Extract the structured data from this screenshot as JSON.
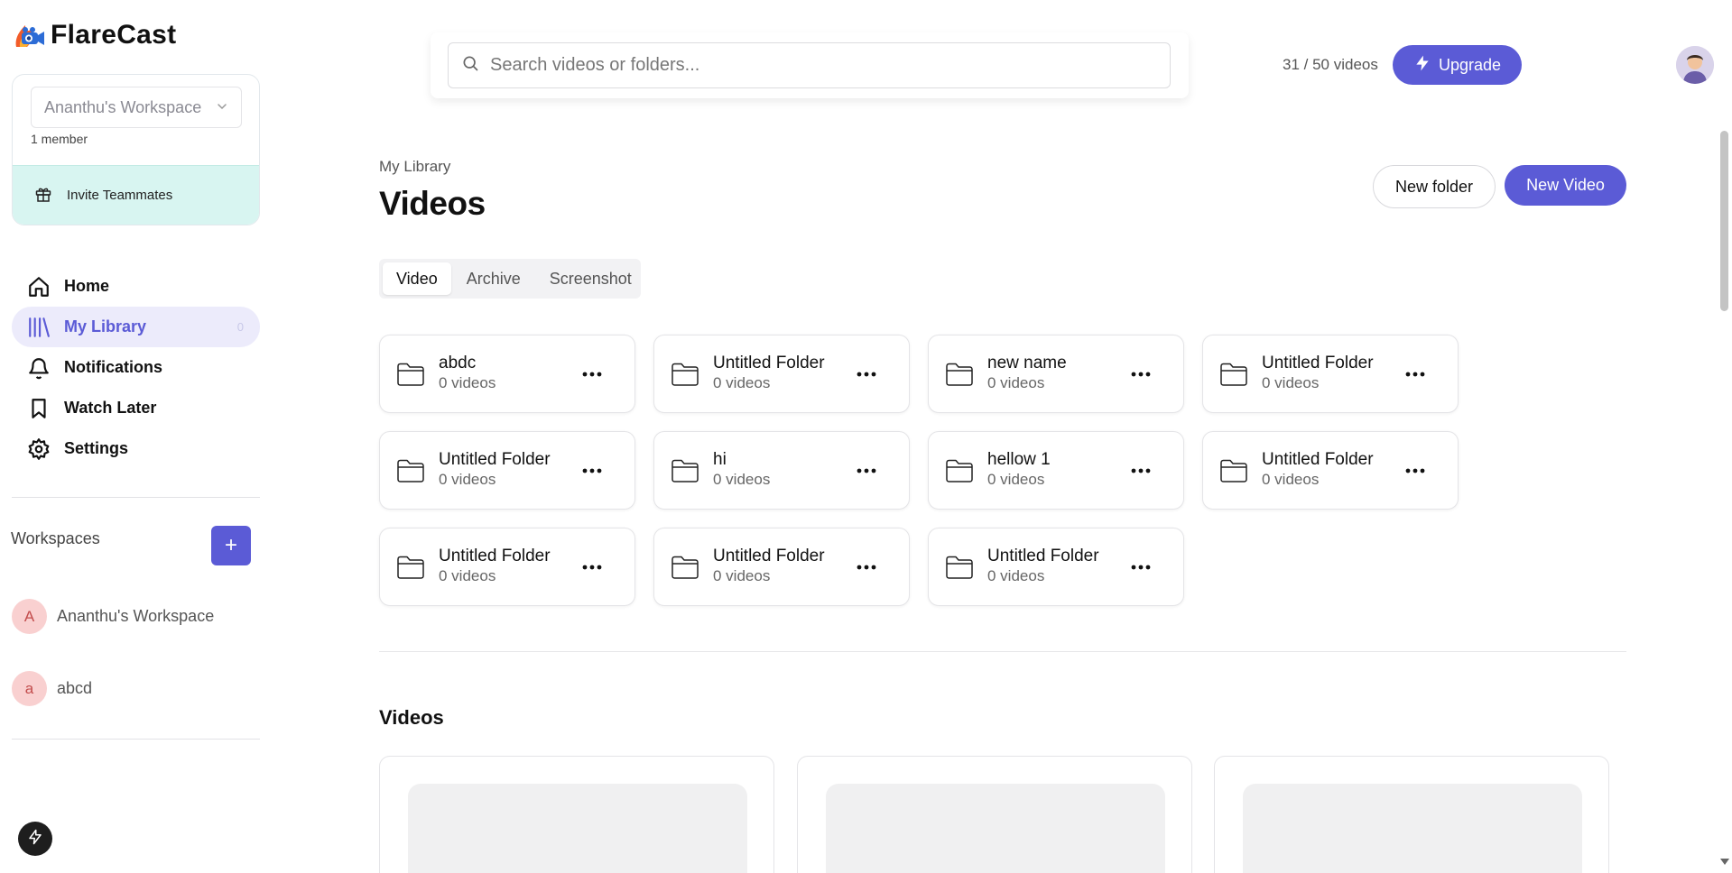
{
  "brand": {
    "name": "FlareCast"
  },
  "workspace_card": {
    "selected": "Ananthu's Workspace",
    "members": "1 member",
    "invite_label": "Invite Teammates"
  },
  "nav": {
    "items": [
      {
        "label": "Home",
        "icon": "home-icon"
      },
      {
        "label": "My Library",
        "icon": "library-icon",
        "count": "0",
        "active": true
      },
      {
        "label": "Notifications",
        "icon": "bell-icon"
      },
      {
        "label": "Watch Later",
        "icon": "bookmark-icon"
      },
      {
        "label": "Settings",
        "icon": "gear-icon"
      }
    ]
  },
  "workspaces": {
    "heading": "Workspaces",
    "add_label": "+",
    "list": [
      {
        "initial": "A",
        "name": "Ananthu's Workspace"
      },
      {
        "initial": "a",
        "name": "abcd"
      }
    ]
  },
  "search": {
    "placeholder": "Search videos or folders..."
  },
  "header": {
    "quota": "31 / 50 videos",
    "upgrade_label": "Upgrade"
  },
  "page": {
    "breadcrumb": "My Library",
    "title": "Videos",
    "new_folder_label": "New folder",
    "new_video_label": "New Video"
  },
  "tabs": [
    "Video",
    "Archive",
    "Screenshot"
  ],
  "active_tab": "Video",
  "folders": [
    {
      "name": "abdc",
      "count": "0 videos"
    },
    {
      "name": "Untitled Folder",
      "count": "0 videos"
    },
    {
      "name": "new name",
      "count": "0 videos"
    },
    {
      "name": "Untitled Folder",
      "count": "0 videos"
    },
    {
      "name": "Untitled Folder",
      "count": "0 videos"
    },
    {
      "name": "hi",
      "count": "0 videos"
    },
    {
      "name": "hellow 1",
      "count": "0 videos"
    },
    {
      "name": "Untitled Folder",
      "count": "0 videos"
    },
    {
      "name": "Untitled Folder",
      "count": "0 videos"
    },
    {
      "name": "Untitled Folder",
      "count": "0 videos"
    },
    {
      "name": "Untitled Folder",
      "count": "0 videos"
    }
  ],
  "videos_section": {
    "title": "Videos"
  },
  "colors": {
    "accent": "#5b5bd6",
    "invite_bg": "#d8f5f1",
    "active_nav_bg": "#ecebfb"
  }
}
